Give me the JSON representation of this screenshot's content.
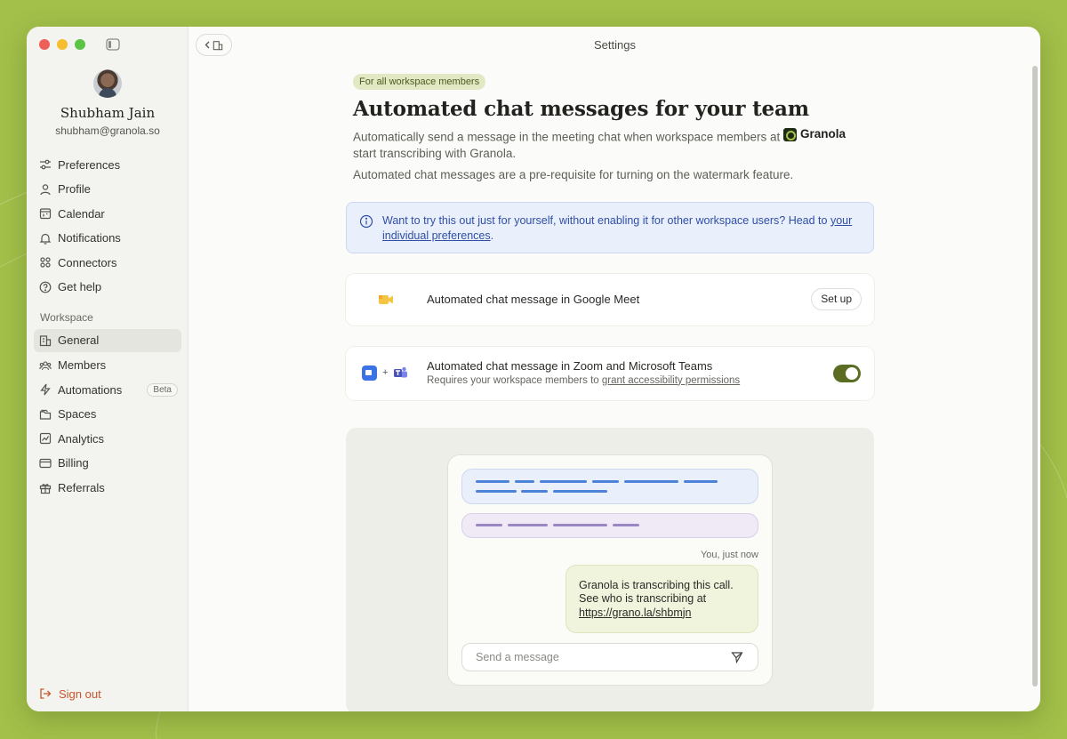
{
  "window": {
    "title": "Settings"
  },
  "user": {
    "name": "Shubham Jain",
    "email": "shubham@granola.so"
  },
  "nav": {
    "items": [
      {
        "label": "Preferences",
        "icon": "sliders-icon"
      },
      {
        "label": "Profile",
        "icon": "person-icon"
      },
      {
        "label": "Calendar",
        "icon": "calendar-icon"
      },
      {
        "label": "Notifications",
        "icon": "bell-icon"
      },
      {
        "label": "Connectors",
        "icon": "connectors-icon"
      },
      {
        "label": "Get help",
        "icon": "help-icon"
      }
    ],
    "workspace_label": "Workspace",
    "workspace_items": [
      {
        "label": "General",
        "icon": "building-icon",
        "active": true
      },
      {
        "label": "Members",
        "icon": "people-icon"
      },
      {
        "label": "Automations",
        "icon": "lightning-icon",
        "badge": "Beta"
      },
      {
        "label": "Spaces",
        "icon": "folder-icon"
      },
      {
        "label": "Analytics",
        "icon": "chart-icon"
      },
      {
        "label": "Billing",
        "icon": "card-icon"
      },
      {
        "label": "Referrals",
        "icon": "gift-icon"
      }
    ],
    "sign_out": "Sign out"
  },
  "page": {
    "badge": "For all workspace members",
    "title": "Automated chat messages for your team",
    "desc_before": "Automatically send a message in the meeting chat when workspace members at",
    "desc_brand": "Granola",
    "desc_after": "start transcribing with Granola.",
    "desc2": "Automated chat messages are a pre-requisite for turning on the watermark feature.",
    "info_text": "Want to try this out just for yourself, without enabling it for other workspace users? Head to",
    "info_link": "your individual preferences",
    "info_end": "."
  },
  "cards": {
    "meet": {
      "title": "Automated chat message in Google Meet",
      "button": "Set up"
    },
    "zoom": {
      "title": "Automated chat message in Zoom and Microsoft Teams",
      "sub_text": "Requires your workspace members to",
      "sub_link": "grant accessibility permissions",
      "plus": "+",
      "enabled": true
    }
  },
  "preview": {
    "meta": "You, just now",
    "message_line1": "Granola is transcribing this call.",
    "message_line2": "See who is transcribing at",
    "message_link": "https://grano.la/shbmjn",
    "input_placeholder": "Send a message"
  },
  "colors": {
    "background": "#a3c04a",
    "accent_toggle": "#5a6d23",
    "sign_out": "#c8552c",
    "info_text": "#2f4ea8"
  }
}
